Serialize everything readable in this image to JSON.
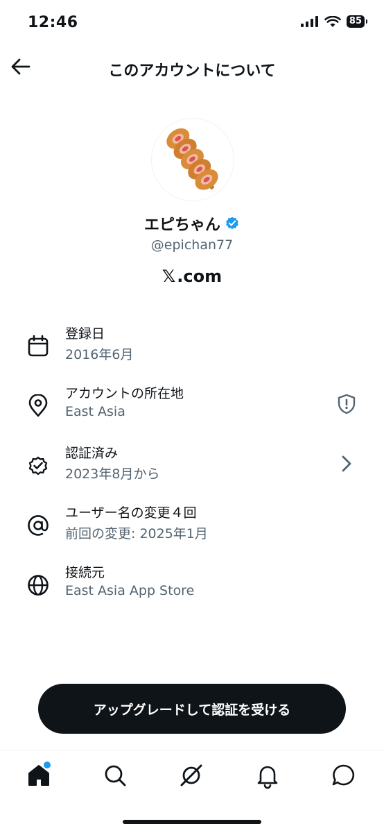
{
  "status_bar": {
    "time": "12:46",
    "battery": "85"
  },
  "header": {
    "title": "このアカウントについて"
  },
  "profile": {
    "display_name": "エピちゃん",
    "handle": "@epichan77",
    "site_x": "𝕏",
    "site_suffix": ".com"
  },
  "details": [
    {
      "title": "登録日",
      "value": "2016年6月",
      "icon": "calendar-icon"
    },
    {
      "title": "アカウントの所在地",
      "value": "East Asia",
      "icon": "location-pin-icon",
      "right_icon": "shield-alert-icon"
    },
    {
      "title": "認証済み",
      "value": "2023年8月から",
      "icon": "verified-badge-icon",
      "right_icon": "chevron-right-icon"
    },
    {
      "title": "ユーザー名の変更４回",
      "value": "前回の変更: 2025年1月",
      "icon": "at-sign-icon"
    },
    {
      "title": "接続元",
      "value": "East Asia App Store",
      "icon": "globe-icon"
    }
  ],
  "cta": {
    "label": "アップグレードして認証を受ける"
  },
  "colors": {
    "accent": "#1d9bf0",
    "text": "#0f1419",
    "muted": "#536471"
  }
}
